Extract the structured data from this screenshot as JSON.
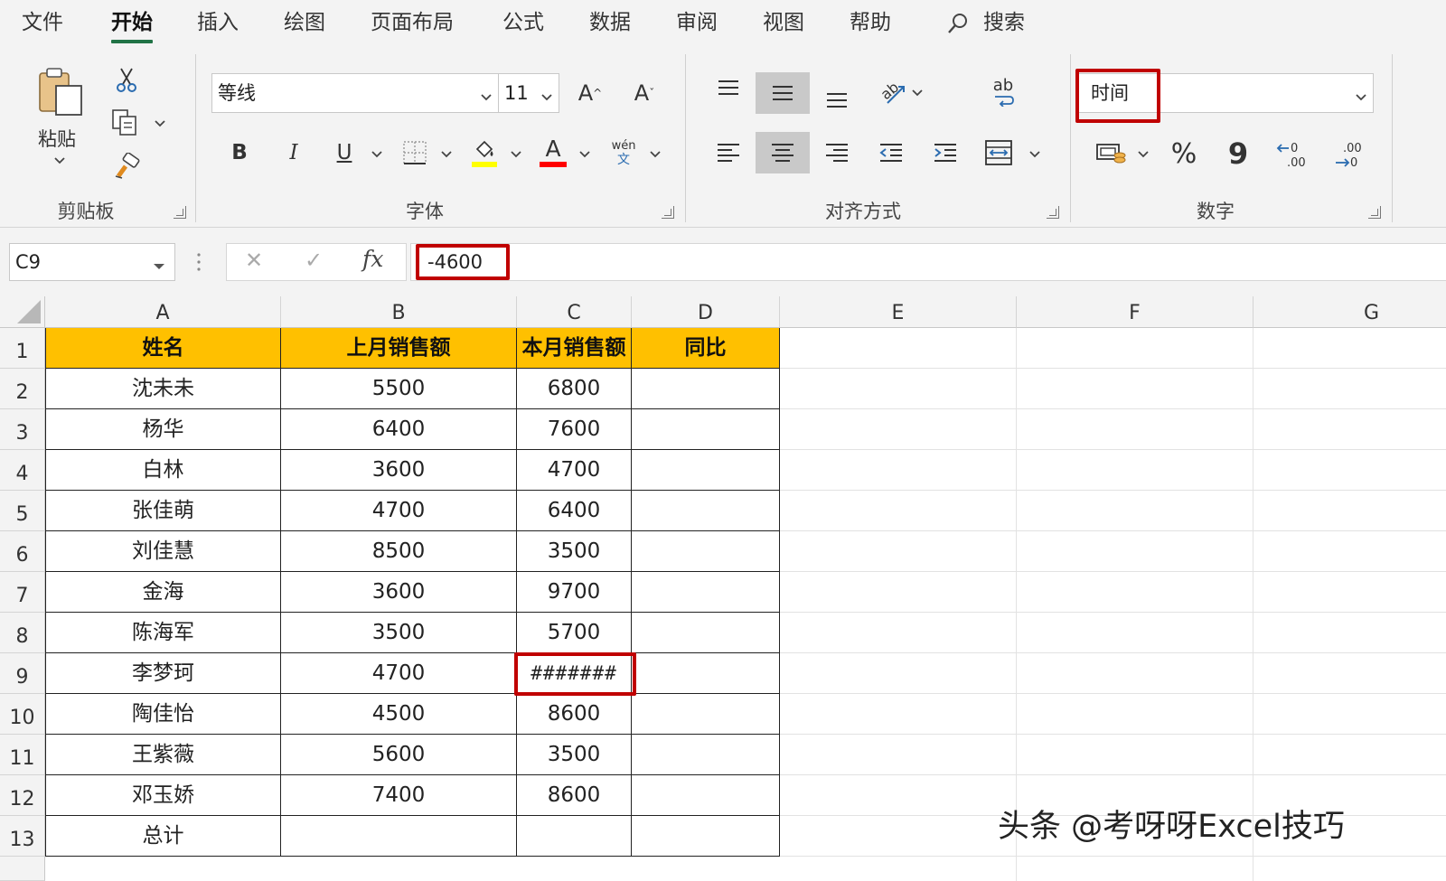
{
  "menu": {
    "tabs": [
      {
        "label": "文件",
        "active": false
      },
      {
        "label": "开始",
        "active": true
      },
      {
        "label": "插入",
        "active": false
      },
      {
        "label": "绘图",
        "active": false
      },
      {
        "label": "页面布局",
        "active": false
      },
      {
        "label": "公式",
        "active": false
      },
      {
        "label": "数据",
        "active": false
      },
      {
        "label": "审阅",
        "active": false
      },
      {
        "label": "视图",
        "active": false
      },
      {
        "label": "帮助",
        "active": false
      }
    ],
    "search_label": "搜索",
    "accent_color": "#217346"
  },
  "ribbon": {
    "clipboard": {
      "label": "剪贴板",
      "paste_label": "粘贴",
      "icons": [
        "paste-icon",
        "cut-icon",
        "copy-icon",
        "format-painter-icon"
      ]
    },
    "font": {
      "label": "字体",
      "font_name": "等线",
      "font_size": "11",
      "phonetic_label": "wén",
      "phonetic_glyph": "文",
      "bold": "B",
      "italic": "I",
      "underline": "U",
      "grow_font": "A",
      "shrink_font": "A",
      "font_color_letter": "A",
      "fill_color": "#ffff00",
      "font_color": "#ff0000"
    },
    "alignment": {
      "label": "对齐方式",
      "wrap_text_glyph": "ab"
    },
    "number": {
      "label": "数字",
      "format_value": "时间",
      "percent": "%",
      "comma": "9",
      "increase_decimal": "←0\n.00",
      "decrease_decimal": ".00\n→0"
    }
  },
  "formula_bar": {
    "name_box": "C9",
    "cancel": "✕",
    "enter": "✓",
    "fx": "fx",
    "value": "-4600"
  },
  "sheet": {
    "columns": [
      "A",
      "B",
      "C",
      "D",
      "E",
      "F",
      "G"
    ],
    "rows": [
      "1",
      "2",
      "3",
      "4",
      "5",
      "6",
      "7",
      "8",
      "9",
      "10",
      "11",
      "12",
      "13"
    ],
    "header_fill": "#ffc000",
    "table": {
      "headers": [
        "姓名",
        "上月销售额",
        "本月销售额",
        "同比"
      ],
      "data": [
        [
          "沈未未",
          "5500",
          "6800",
          ""
        ],
        [
          "杨华",
          "6400",
          "7600",
          ""
        ],
        [
          "白林",
          "3600",
          "4700",
          ""
        ],
        [
          "张佳萌",
          "4700",
          "6400",
          ""
        ],
        [
          "刘佳慧",
          "8500",
          "3500",
          ""
        ],
        [
          "金海",
          "3600",
          "9700",
          ""
        ],
        [
          "陈海军",
          "3500",
          "5700",
          ""
        ],
        [
          "李梦珂",
          "4700",
          "#######",
          ""
        ],
        [
          "陶佳怡",
          "4500",
          "8600",
          ""
        ],
        [
          "王紫薇",
          "5600",
          "3500",
          ""
        ],
        [
          "邓玉娇",
          "7400",
          "8600",
          ""
        ],
        [
          "总计",
          "",
          "",
          ""
        ]
      ]
    }
  },
  "watermark": "头条 @考呀呀Excel技巧",
  "highlight_color": "#c00000"
}
